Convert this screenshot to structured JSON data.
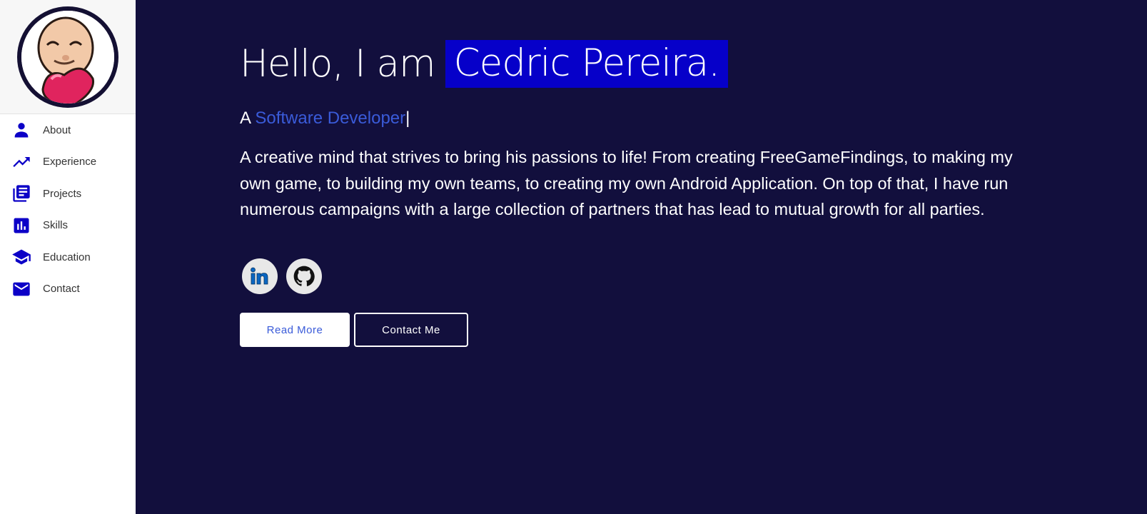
{
  "sidebar": {
    "avatar_icon": "cartoon-avatar-with-heart",
    "items": [
      {
        "label": "About",
        "icon": "person-icon"
      },
      {
        "label": "Experience",
        "icon": "trending-up-icon"
      },
      {
        "label": "Projects",
        "icon": "library-books-icon"
      },
      {
        "label": "Skills",
        "icon": "bar-chart-icon"
      },
      {
        "label": "Education",
        "icon": "graduation-cap-icon"
      },
      {
        "label": "Contact",
        "icon": "mail-icon"
      }
    ]
  },
  "hero": {
    "greeting": "Hello, I am",
    "name": "Cedric Pereira.",
    "subtitle_prefix": "A",
    "role": "Software Developer",
    "cursor": "|",
    "bio": "A creative mind that strives to bring his passions to life! From creating FreeGameFindings, to making my own game, to building my own teams, to creating my own Android Application. On top of that, I have run numerous campaigns with a large collection of partners that has lead to mutual growth for all parties."
  },
  "socials": [
    {
      "icon": "linkedin-icon"
    },
    {
      "icon": "github-icon"
    }
  ],
  "actions": {
    "read_more": "Read More",
    "contact_me": "Contact Me"
  },
  "colors": {
    "background": "#120f3d",
    "accent": "#0600c9",
    "role_text": "#3a5bd9",
    "icon": "#0c00c7"
  }
}
